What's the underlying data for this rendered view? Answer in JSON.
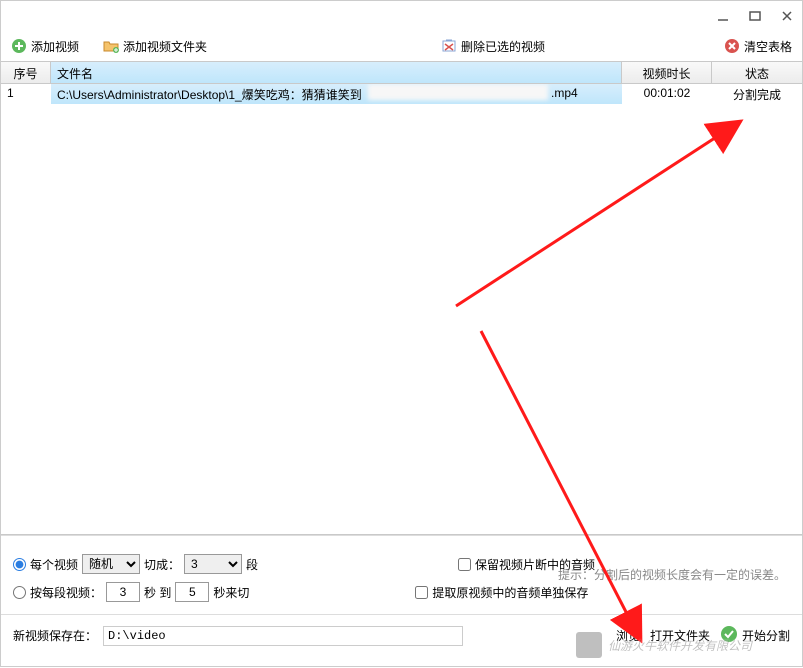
{
  "toolbar": {
    "add_video": "添加视频",
    "add_folder": "添加视频文件夹",
    "delete_selected": "删除已选的视频",
    "clear_table": "清空表格"
  },
  "grid": {
    "headers": {
      "seq": "序号",
      "name": "文件名",
      "duration": "视频时长",
      "status": "状态"
    },
    "rows": [
      {
        "seq": "1",
        "name_prefix": "C:\\Users\\Administrator\\Desktop\\1_爆笑吃鸡：猜猜谁笑到",
        "name_suffix": ".mp4",
        "duration": "00:01:02",
        "status": "分割完成"
      }
    ]
  },
  "options": {
    "per_video_label": "每个视频",
    "random_option": "随机",
    "cut_into": "切成：",
    "segments_option": "3",
    "segments_unit": "段",
    "per_segment_label": "按每段视频：",
    "sec_value": "3",
    "sec_to": "秒 到",
    "to_value": "5",
    "sec_cut": "秒来切",
    "keep_audio": "保留视频片断中的音频",
    "extract_audio": "提取原视频中的音频单独保存",
    "hint": "提示：分割后的视频长度会有一定的误差。"
  },
  "bottom": {
    "save_label": "新视频保存在：",
    "save_path": "D:\\video",
    "browse": "浏览",
    "open_folder": "打开文件夹",
    "start_split": "开始分割"
  },
  "watermark": "仙游火牛软件开发有限公司"
}
